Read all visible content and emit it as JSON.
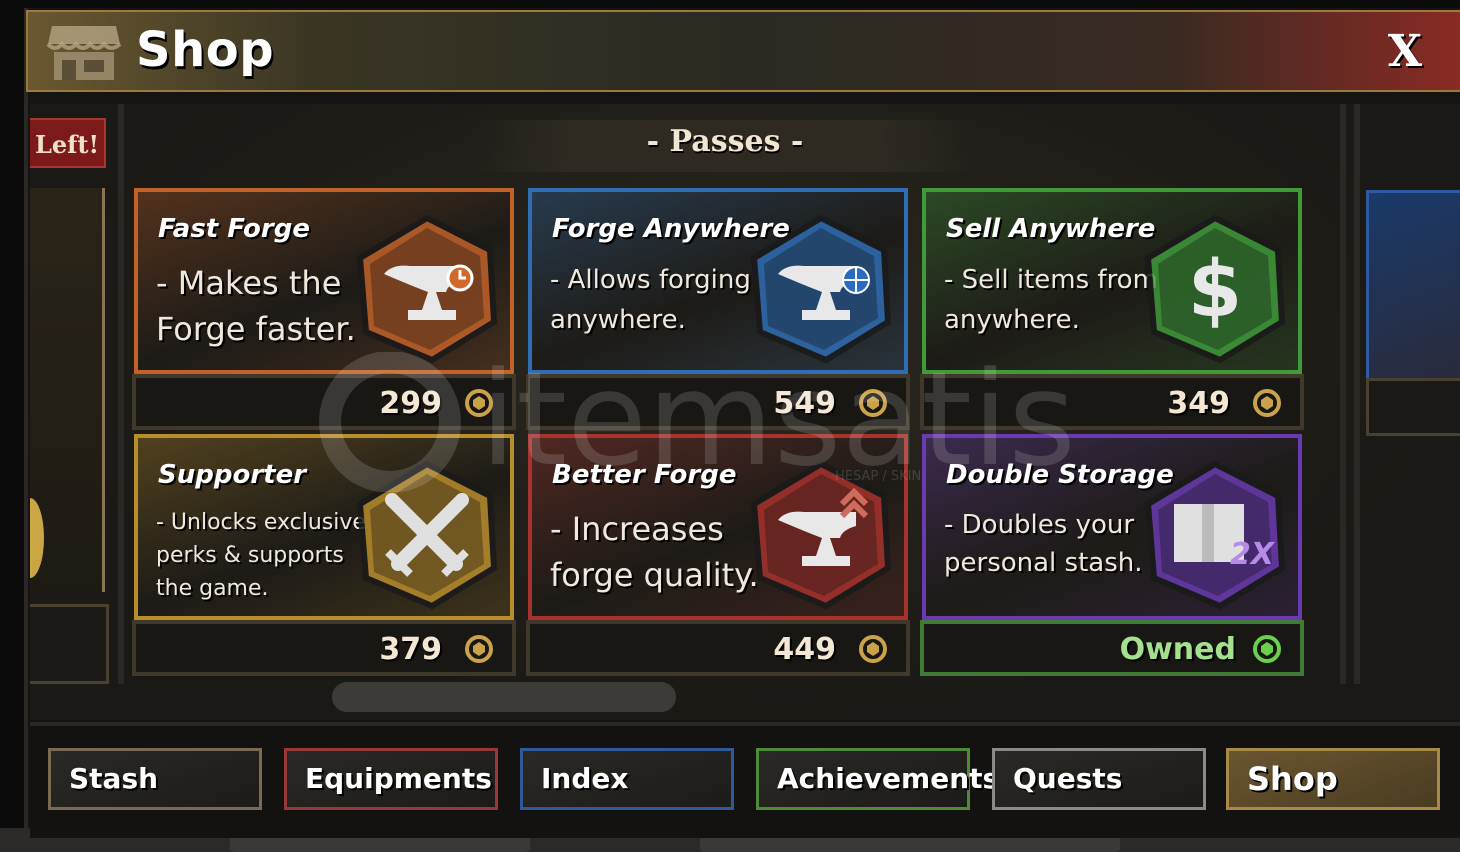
{
  "header": {
    "title": "Shop",
    "close_label": "X"
  },
  "left_banner": "Left!",
  "section_title": "- Passes -",
  "cards": [
    {
      "name": "Fast Forge",
      "desc": "- Makes the\nForge faster.",
      "price": "299",
      "color": "#c2622a",
      "emblem": "anvil-clock-icon"
    },
    {
      "name": "Forge Anywhere",
      "desc": "- Allows forging\nanywhere.",
      "price": "549",
      "color": "#2f6db4",
      "emblem": "anvil-globe-icon"
    },
    {
      "name": "Sell Anywhere",
      "desc": "- Sell items from\nanywhere.",
      "price": "349",
      "color": "#3f9a3a",
      "emblem": "dollar-sign-icon"
    },
    {
      "name": "Supporter",
      "desc": "- Unlocks exclusive\nperks & supports\nthe game.",
      "price": "379",
      "color": "#b98d2c",
      "emblem": "crossed-swords-icon"
    },
    {
      "name": "Better Forge",
      "desc": "- Increases\nforge quality.",
      "price": "449",
      "color": "#a8322d",
      "emblem": "anvil-upgrade-icon"
    },
    {
      "name": "Double Storage",
      "desc": "- Doubles your\npersonal stash.",
      "price": "Owned",
      "color": "#6a3bb0",
      "emblem": "chest-2x-icon"
    }
  ],
  "tabs": [
    {
      "label": "Stash",
      "color": "#7a6a52"
    },
    {
      "label": "Equipments",
      "color": "#9a3838"
    },
    {
      "label": "Index",
      "color": "#2f5a9a"
    },
    {
      "label": "Achievements",
      "color": "#4e8a3a"
    },
    {
      "label": "Quests",
      "color": "#8a8a8a"
    },
    {
      "label": "Shop",
      "color": "#a88a46"
    }
  ],
  "watermark": "itemsatis",
  "watermark_sub": "HESAP / SKIN"
}
